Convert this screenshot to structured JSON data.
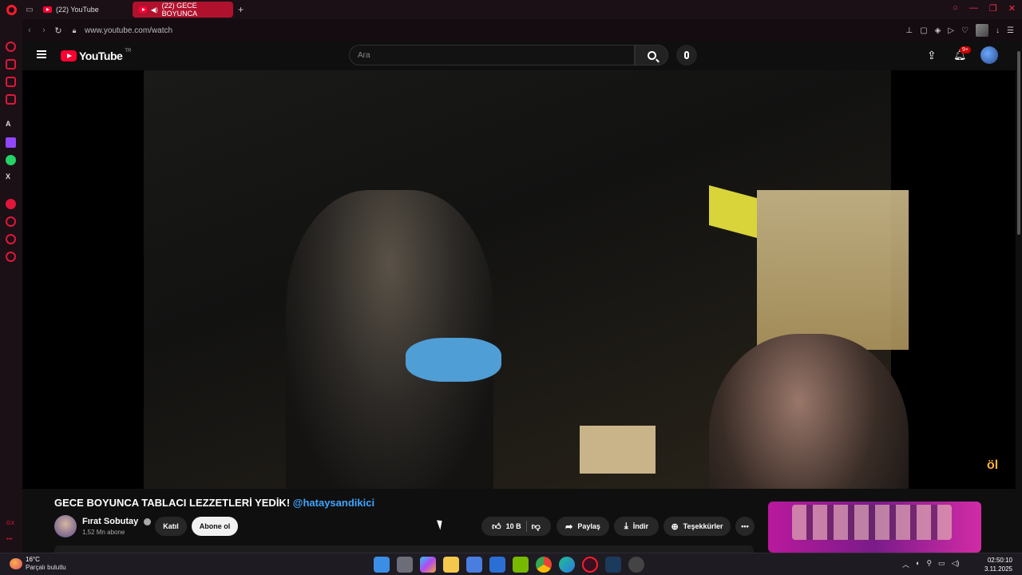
{
  "browser": {
    "tabs": [
      {
        "label": "(22) YouTube"
      },
      {
        "label": "(22) GECE BOYUNCA"
      }
    ],
    "url": "www.youtube.com/watch"
  },
  "youtube": {
    "logo_text": "YouTube",
    "region": "TR",
    "search_placeholder": "Ara",
    "notifications_badge": "9+"
  },
  "video": {
    "title": "GECE BOYUNCA TABLACI LEZZETLERİ YEDİK!",
    "mention": "@hataysandikici",
    "channel_name": "Fırat Sobutay",
    "subscribers": "1,52 Mn abone",
    "join_label": "Katıl",
    "subscribe_label": "Abone ol",
    "likes": "10 B",
    "share_label": "Paylaş",
    "download_label": "İndir",
    "thanks_label": "Teşekkürler",
    "more_label": "•••"
  },
  "taskbar": {
    "temperature": "16°C",
    "weather": "Parçalı bulutlu",
    "time": "02:50:10",
    "date": "3.11.2025"
  },
  "colors": {
    "opera_red": "#ff1b2d",
    "youtube_red": "#ff0033",
    "link_blue": "#3ea6ff"
  }
}
